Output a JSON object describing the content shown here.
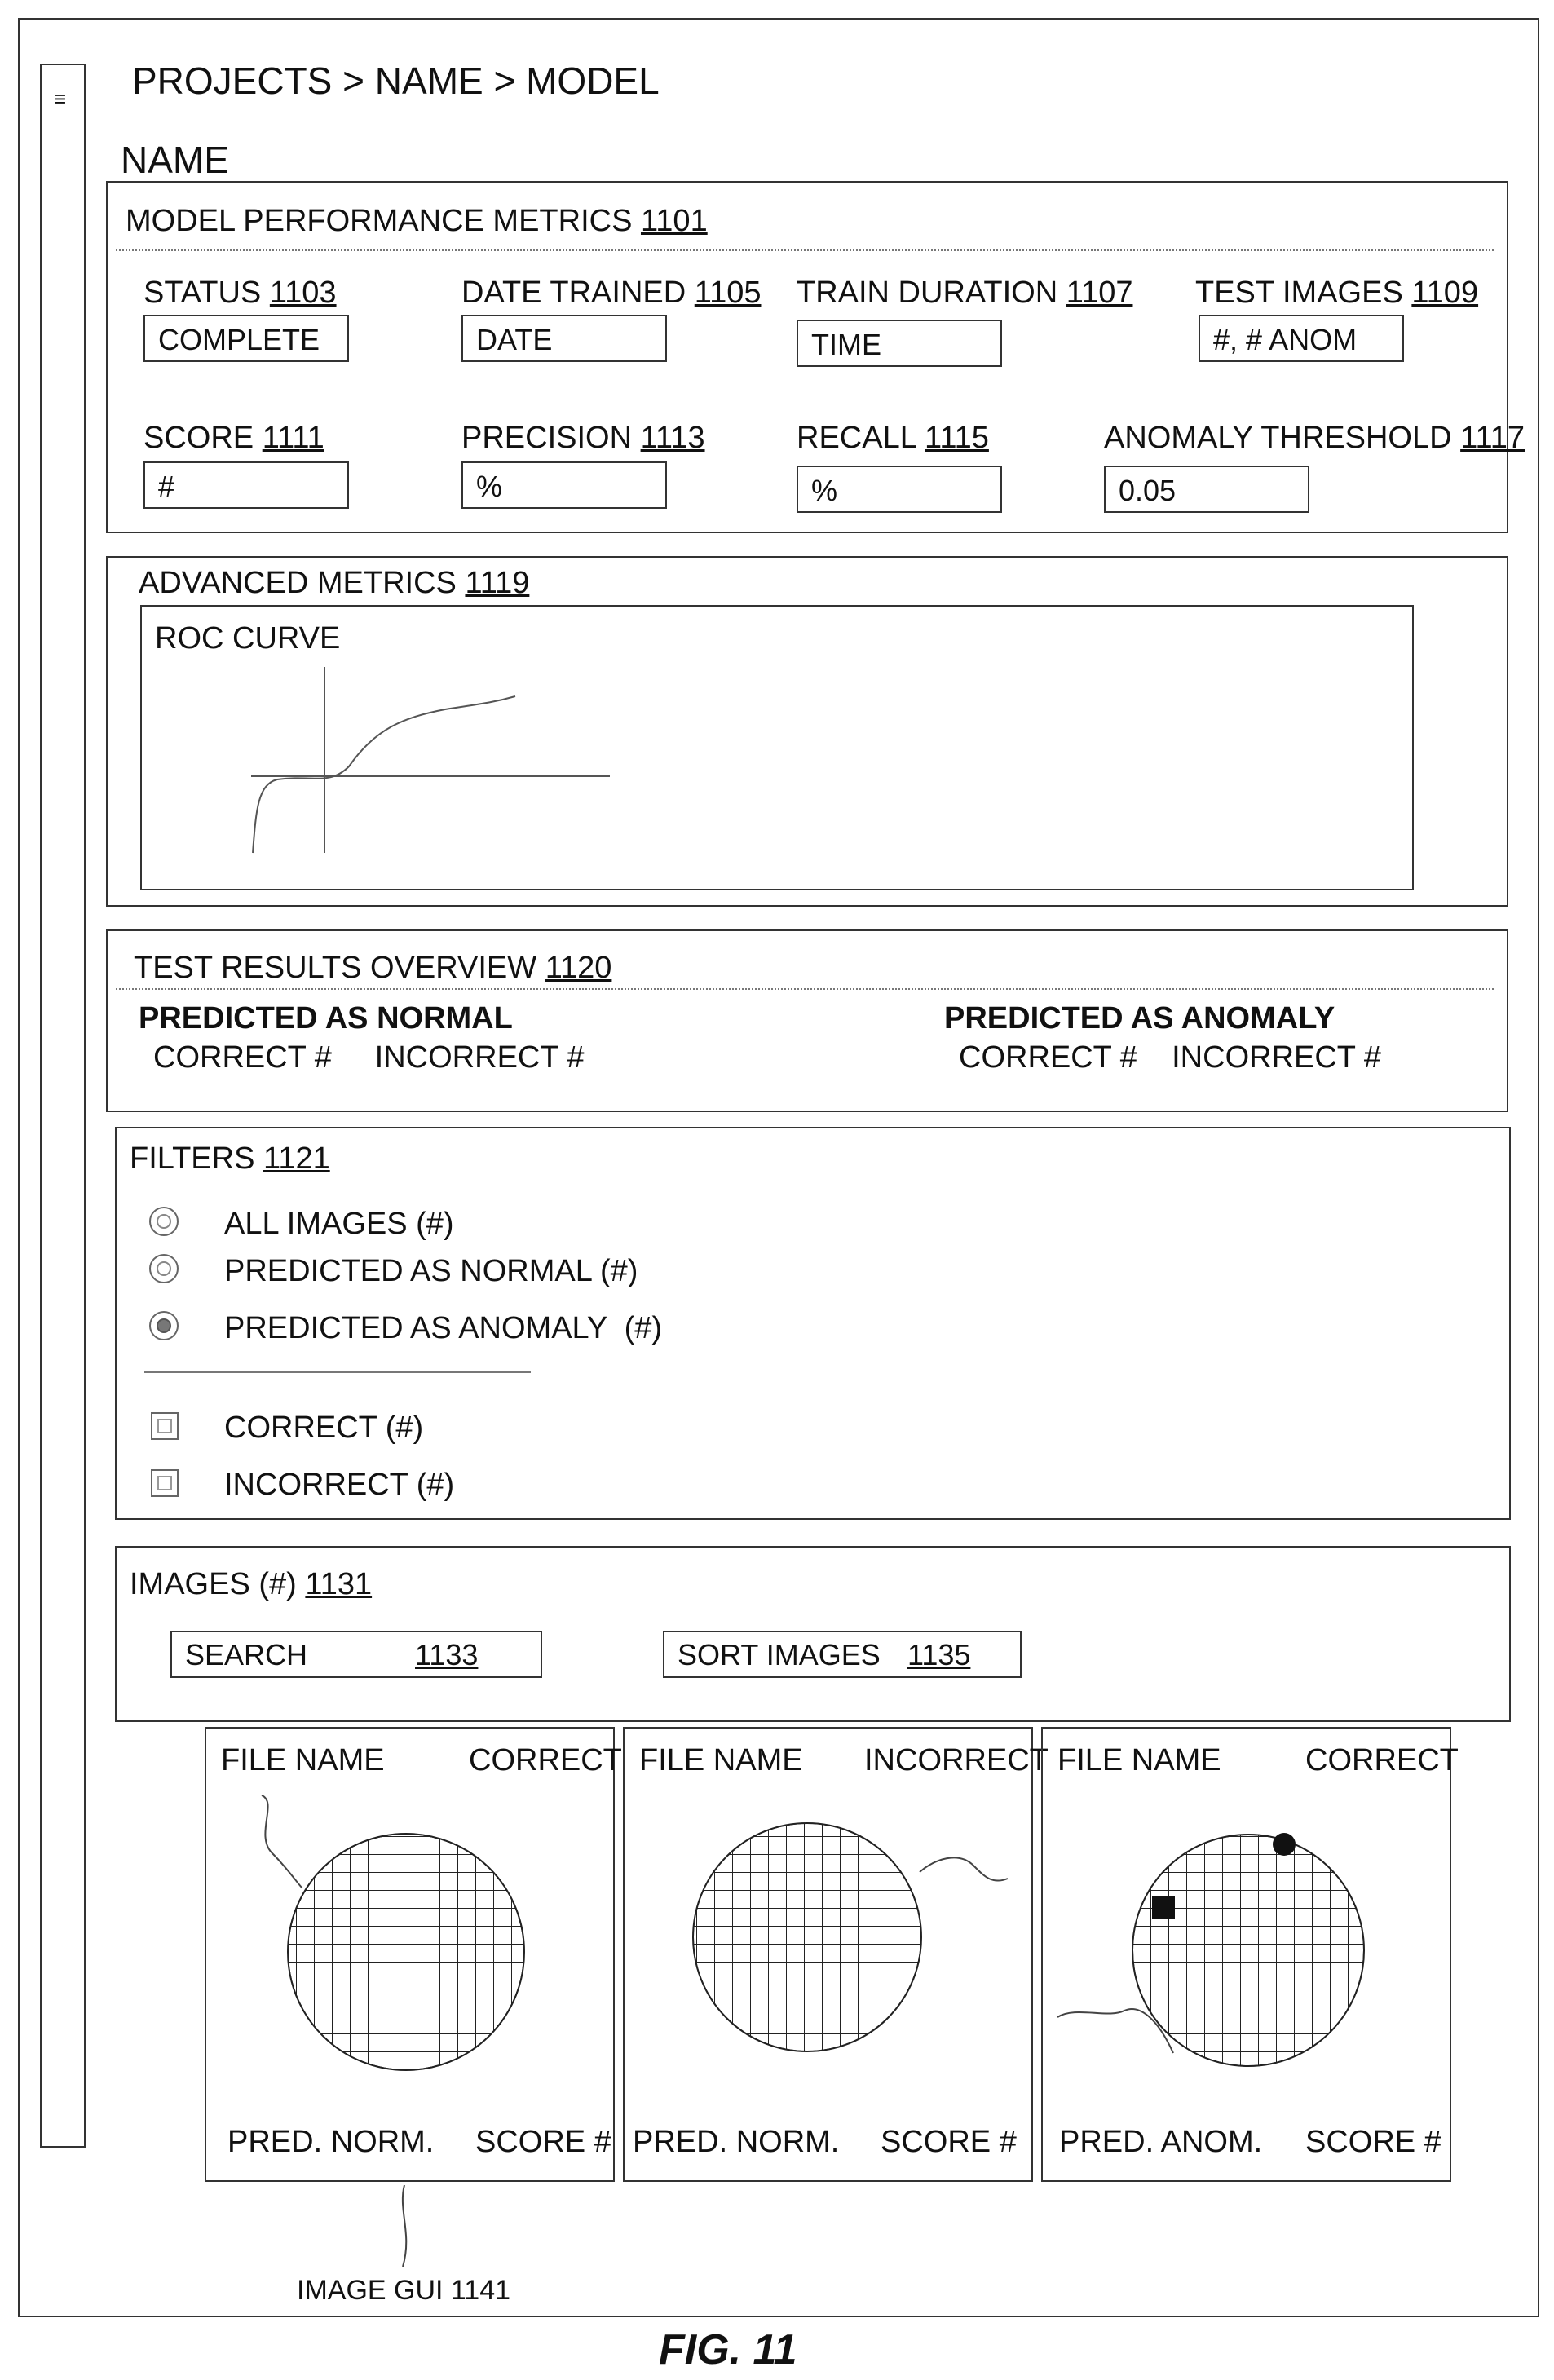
{
  "breadcrumb": "PROJECTS > NAME > MODEL",
  "sidebar": {
    "menu_icon": "≡"
  },
  "model_name": "NAME",
  "performance": {
    "title": "MODEL PERFORMANCE METRICS",
    "ref": "1101",
    "metrics": [
      {
        "label": "STATUS",
        "ref": "1103",
        "value": "COMPLETE"
      },
      {
        "label": "DATE TRAINED",
        "ref": "1105",
        "value": "DATE"
      },
      {
        "label": "TRAIN DURATION",
        "ref": "1107",
        "value": "TIME"
      },
      {
        "label": "TEST IMAGES",
        "ref": "1109",
        "value": "#, # ANOM"
      },
      {
        "label": "SCORE",
        "ref": "1111",
        "value": "#"
      },
      {
        "label": "PRECISION",
        "ref": "1113",
        "value": "%"
      },
      {
        "label": "RECALL",
        "ref": "1115",
        "value": "%"
      },
      {
        "label": "ANOMALY THRESHOLD",
        "ref": "1117",
        "value": "0.05"
      }
    ]
  },
  "advanced": {
    "title": "ADVANCED METRICS",
    "ref": "1119",
    "roc_title": "ROC CURVE"
  },
  "test_results": {
    "title": "TEST RESULTS OVERVIEW",
    "ref": "1120",
    "normal_heading": "PREDICTED AS NORMAL",
    "normal_detail": "CORRECT #     INCORRECT #",
    "anomaly_heading": "PREDICTED AS ANOMALY",
    "anomaly_detail": "CORRECT #    INCORRECT #"
  },
  "filters": {
    "title": "FILTERS",
    "ref": "1121",
    "radios": [
      {
        "label": "ALL IMAGES (#)",
        "selected": false
      },
      {
        "label": "PREDICTED AS NORMAL (#)",
        "selected": false
      },
      {
        "label": "PREDICTED AS ANOMALY  (#)",
        "selected": true
      }
    ],
    "checkboxes": [
      {
        "label": "CORRECT (#)",
        "checked": false
      },
      {
        "label": "INCORRECT (#)",
        "checked": false
      }
    ]
  },
  "images": {
    "title": "IMAGES (#)",
    "ref": "1131",
    "search_label": "SEARCH",
    "search_ref": "1133",
    "sort_label": "SORT IMAGES",
    "sort_ref": "1135"
  },
  "image_cards": [
    {
      "file_name": "FILE NAME",
      "result": "CORRECT",
      "prediction": "PRED. NORM.",
      "score": "SCORE #"
    },
    {
      "file_name": "FILE NAME",
      "result": "INCORRECT",
      "prediction": "PRED. NORM.",
      "score": "SCORE #"
    },
    {
      "file_name": "FILE NAME",
      "result": "CORRECT",
      "prediction": "PRED. ANOM.",
      "score": "SCORE #"
    }
  ],
  "image_gui_label": "IMAGE GUI 1141",
  "figure_label": "FIG. 11"
}
